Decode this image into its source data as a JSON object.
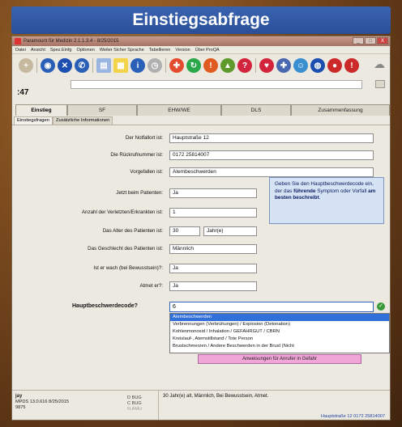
{
  "banner": {
    "title": "Einstiegsabfrage"
  },
  "window": {
    "title": "Paramount für Medizin 2.1.1.3.4 - 8/25/2015",
    "controls": {
      "minimize": "_",
      "maximize": "□",
      "close": "X"
    }
  },
  "menu": [
    "Datei",
    "Ansicht",
    "Spez.Einfg",
    "Optionen",
    "Weiter Sicher Sprache",
    "Tabellieren",
    "Version",
    "Über ProQA"
  ],
  "toolbar": {
    "icons": [
      {
        "name": "plus-icon",
        "glyph": "+",
        "color": "#c6b9a0"
      },
      {
        "name": "globe-icon",
        "glyph": "◉",
        "color": "#2a5fb8"
      },
      {
        "name": "stop-icon",
        "glyph": "✕",
        "color": "#1d4fb0"
      },
      {
        "name": "phone-icon",
        "glyph": "✆",
        "color": "#2a5fb8"
      },
      {
        "name": "document-icon",
        "glyph": "▤",
        "color": "#9ab6e0"
      },
      {
        "name": "note-icon",
        "glyph": "▦",
        "color": "#f2d34a"
      },
      {
        "name": "info-icon",
        "glyph": "i",
        "color": "#2a5fb8"
      },
      {
        "name": "clock-icon",
        "glyph": "◷",
        "color": "#b0b0b0"
      },
      {
        "name": "ambulance-icon",
        "glyph": "✚",
        "color": "#e44c2f"
      },
      {
        "name": "refresh-icon",
        "glyph": "↻",
        "color": "#2aa84a"
      },
      {
        "name": "alert-icon",
        "glyph": "!",
        "color": "#e05b20"
      },
      {
        "name": "hazard-icon",
        "glyph": "▲",
        "color": "#5e9a2c"
      },
      {
        "name": "help-icon",
        "glyph": "?",
        "color": "#d2243c"
      },
      {
        "name": "heart-icon",
        "glyph": "♥",
        "color": "#d2243c"
      },
      {
        "name": "cross-icon",
        "glyph": "✚",
        "color": "#4a68b0"
      },
      {
        "name": "person-icon",
        "glyph": "☺",
        "color": "#3a8fd0"
      },
      {
        "name": "world-icon",
        "glyph": "◍",
        "color": "#1d4fb0"
      },
      {
        "name": "record-icon",
        "glyph": "●",
        "color": "#cc2a2a"
      },
      {
        "name": "exclamation-icon",
        "glyph": "!",
        "color": "#cc2a2a"
      }
    ]
  },
  "case_id": ":47",
  "tabs": [
    "Einstieg",
    "SF",
    "EHW/WE",
    "DLS",
    "Zusammenfassung"
  ],
  "subtabs": [
    "Einstiegsfragen",
    "Zusätzliche Informationen"
  ],
  "form": {
    "fields": [
      {
        "label": "Der Notfallort ist:",
        "value": "Hauptstraße 12"
      },
      {
        "label": "Die Rückrufnummer ist:",
        "value": "0172 25814007"
      },
      {
        "label": "Vorgefallen ist:",
        "value": "Atembeschwerden"
      },
      {
        "label": "Jetzt beim Patienten:",
        "value": "Ja"
      },
      {
        "label": "Anzahl der Verletzten/Erkrankten ist:",
        "value": "1"
      },
      {
        "label": "Das Alter des Patienten ist:",
        "value": "30"
      },
      {
        "label": "Das Geschlecht des Patienten ist:",
        "value": "Männlich"
      },
      {
        "label": "Ist er wach (bei Bewusstsein)?:",
        "value": "Ja"
      },
      {
        "label": "Atmet er?:",
        "value": "Ja"
      }
    ],
    "age_unit": "Jahr(e)",
    "hint": {
      "pre": "Geben Sie den Hauptbeschwerdecode ein, der das ",
      "b1": "führende",
      "mid": " Symptom oder Vorfall ",
      "b2": "am besten beschreibt",
      "post": "."
    },
    "chief_complaint_label": "Hauptbeschwerdecode?",
    "chief_complaint_value": "6",
    "dropdown": [
      "Atembeschwerden",
      "Verbrennungen (Verbrühungen) / Explosion (Detonation)",
      "Kohlenmonoxid / Inhalation / GEFAHRGUT / CBRN",
      "Kreislauf-, Atemstillstand / Tote Person",
      "Brustschmerzen / Andere Beschwerden in der Brust (Nicht"
    ],
    "instructions_button": "Anweisungen für Anrufer in Gefahr"
  },
  "status": {
    "user": "jay",
    "line2": "MPDS 13.0.616 8/25/2015",
    "line3": "9875",
    "col": [
      "D BUG",
      "C BUG",
      "N.AMU"
    ],
    "summary": "30 Jahr(e) alt, Männlich, Bei Bewusstsein, Atmet.",
    "address": "Hauptstraße 12  0172 25814007"
  }
}
